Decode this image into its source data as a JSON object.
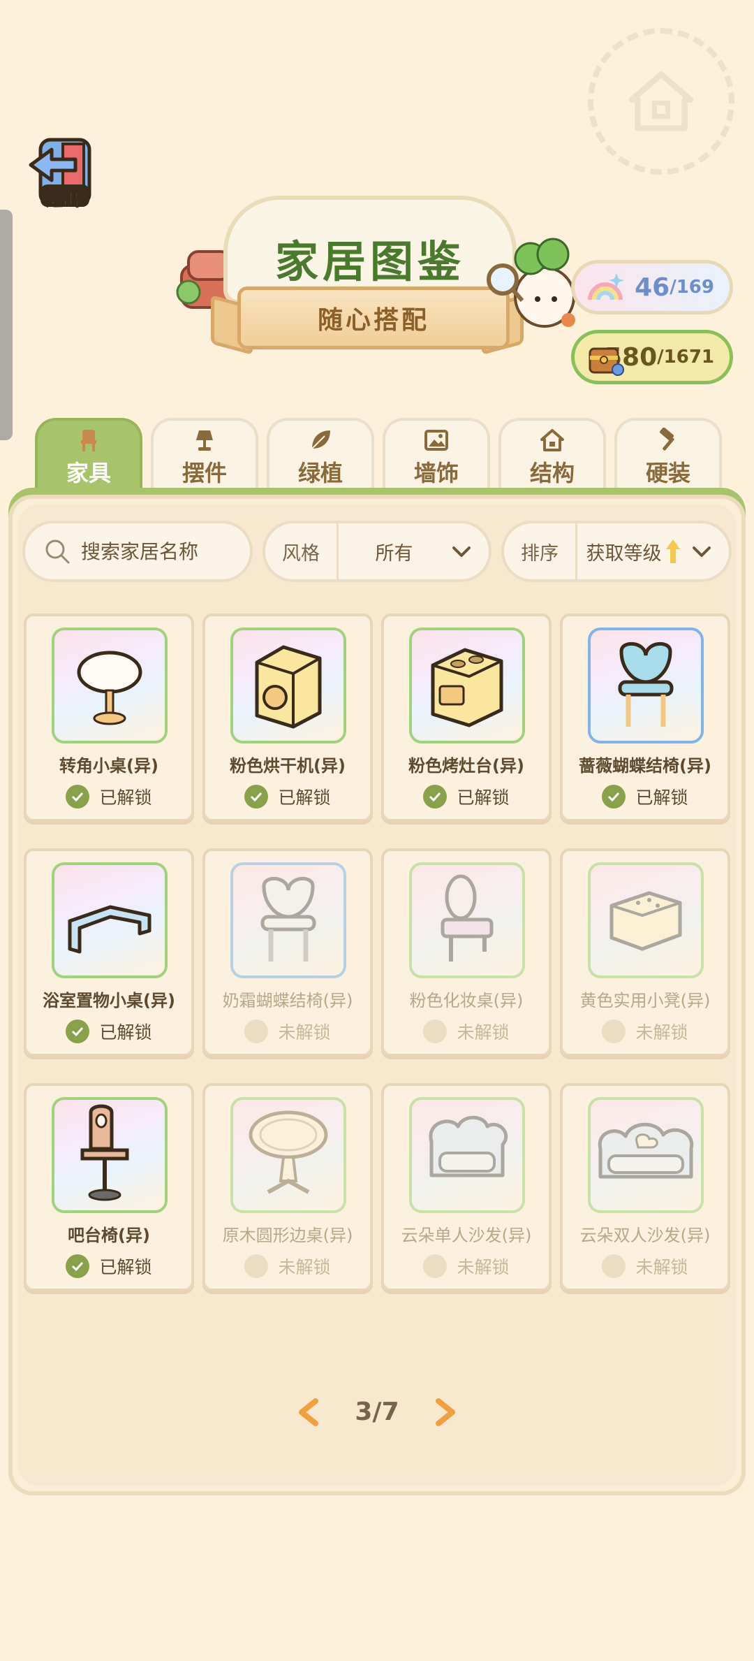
{
  "header": {
    "exit_label": "退出",
    "title": "家居图鉴",
    "subtitle": "随心搭配"
  },
  "stats": {
    "collected": "46",
    "collected_total": "/169",
    "points": "580",
    "points_total": "/1671"
  },
  "tabs": [
    {
      "label": "家具",
      "icon": "chair-icon",
      "active": true
    },
    {
      "label": "摆件",
      "icon": "lamp-icon",
      "active": false
    },
    {
      "label": "绿植",
      "icon": "leaf-icon",
      "active": false
    },
    {
      "label": "墙饰",
      "icon": "picture-icon",
      "active": false
    },
    {
      "label": "结构",
      "icon": "house-icon",
      "active": false
    },
    {
      "label": "硬装",
      "icon": "hammer-icon",
      "active": false
    }
  ],
  "toolbar": {
    "search_placeholder": "搜索家居名称",
    "style_label": "风格",
    "style_value": "所有",
    "sort_label": "排序",
    "sort_value": "获取等级"
  },
  "items": [
    {
      "name": "转角小桌(异)",
      "status": "已解锁",
      "unlocked": true
    },
    {
      "name": "粉色烘干机(异)",
      "status": "已解锁",
      "unlocked": true
    },
    {
      "name": "粉色烤灶台(异)",
      "status": "已解锁",
      "unlocked": true
    },
    {
      "name": "蔷薇蝴蝶结椅(异)",
      "status": "已解锁",
      "unlocked": true
    },
    {
      "name": "浴室置物小桌(异)",
      "status": "已解锁",
      "unlocked": true
    },
    {
      "name": "奶霜蝴蝶结椅(异)",
      "status": "未解锁",
      "unlocked": false
    },
    {
      "name": "粉色化妆桌(异)",
      "status": "未解锁",
      "unlocked": false
    },
    {
      "name": "黄色实用小凳(异)",
      "status": "未解锁",
      "unlocked": false
    },
    {
      "name": "吧台椅(异)",
      "status": "已解锁",
      "unlocked": true
    },
    {
      "name": "原木圆形边桌(异)",
      "status": "未解锁",
      "unlocked": false
    },
    {
      "name": "云朵单人沙发(异)",
      "status": "未解锁",
      "unlocked": false
    },
    {
      "name": "云朵双人沙发(异)",
      "status": "未解锁",
      "unlocked": false
    }
  ],
  "pager": {
    "label": "3/7"
  },
  "colors": {
    "background": "#fdf1dc",
    "accent_green": "#a8c46a",
    "unlocked_check": "#8aa04a",
    "orange_arrow": "#f0a040"
  }
}
